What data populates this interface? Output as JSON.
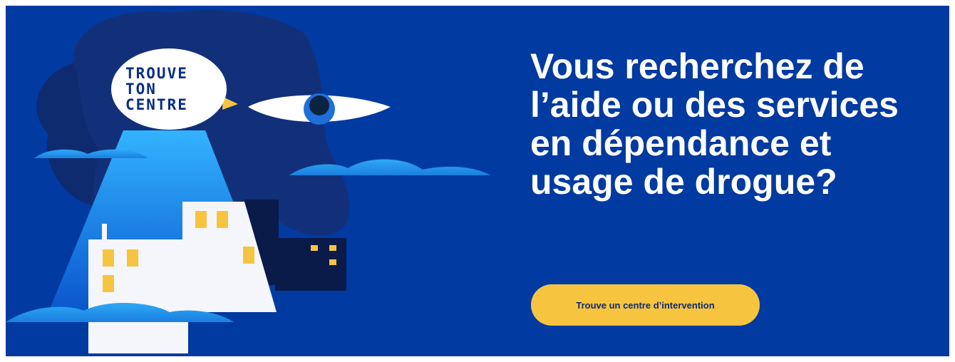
{
  "logo": {
    "line1": "TROUVE",
    "line2": "TON",
    "line3": "CENTRE"
  },
  "hero": {
    "headline": "Vous recherchez de l’aide ou des services en dépendance et usage de drogue?",
    "cta_label": "Trouve un centre d’intervention"
  },
  "colors": {
    "background": "#013aa0",
    "cta": "#f7c440",
    "headline_text": "#ffffff",
    "logo_text": "#0a2e86"
  }
}
